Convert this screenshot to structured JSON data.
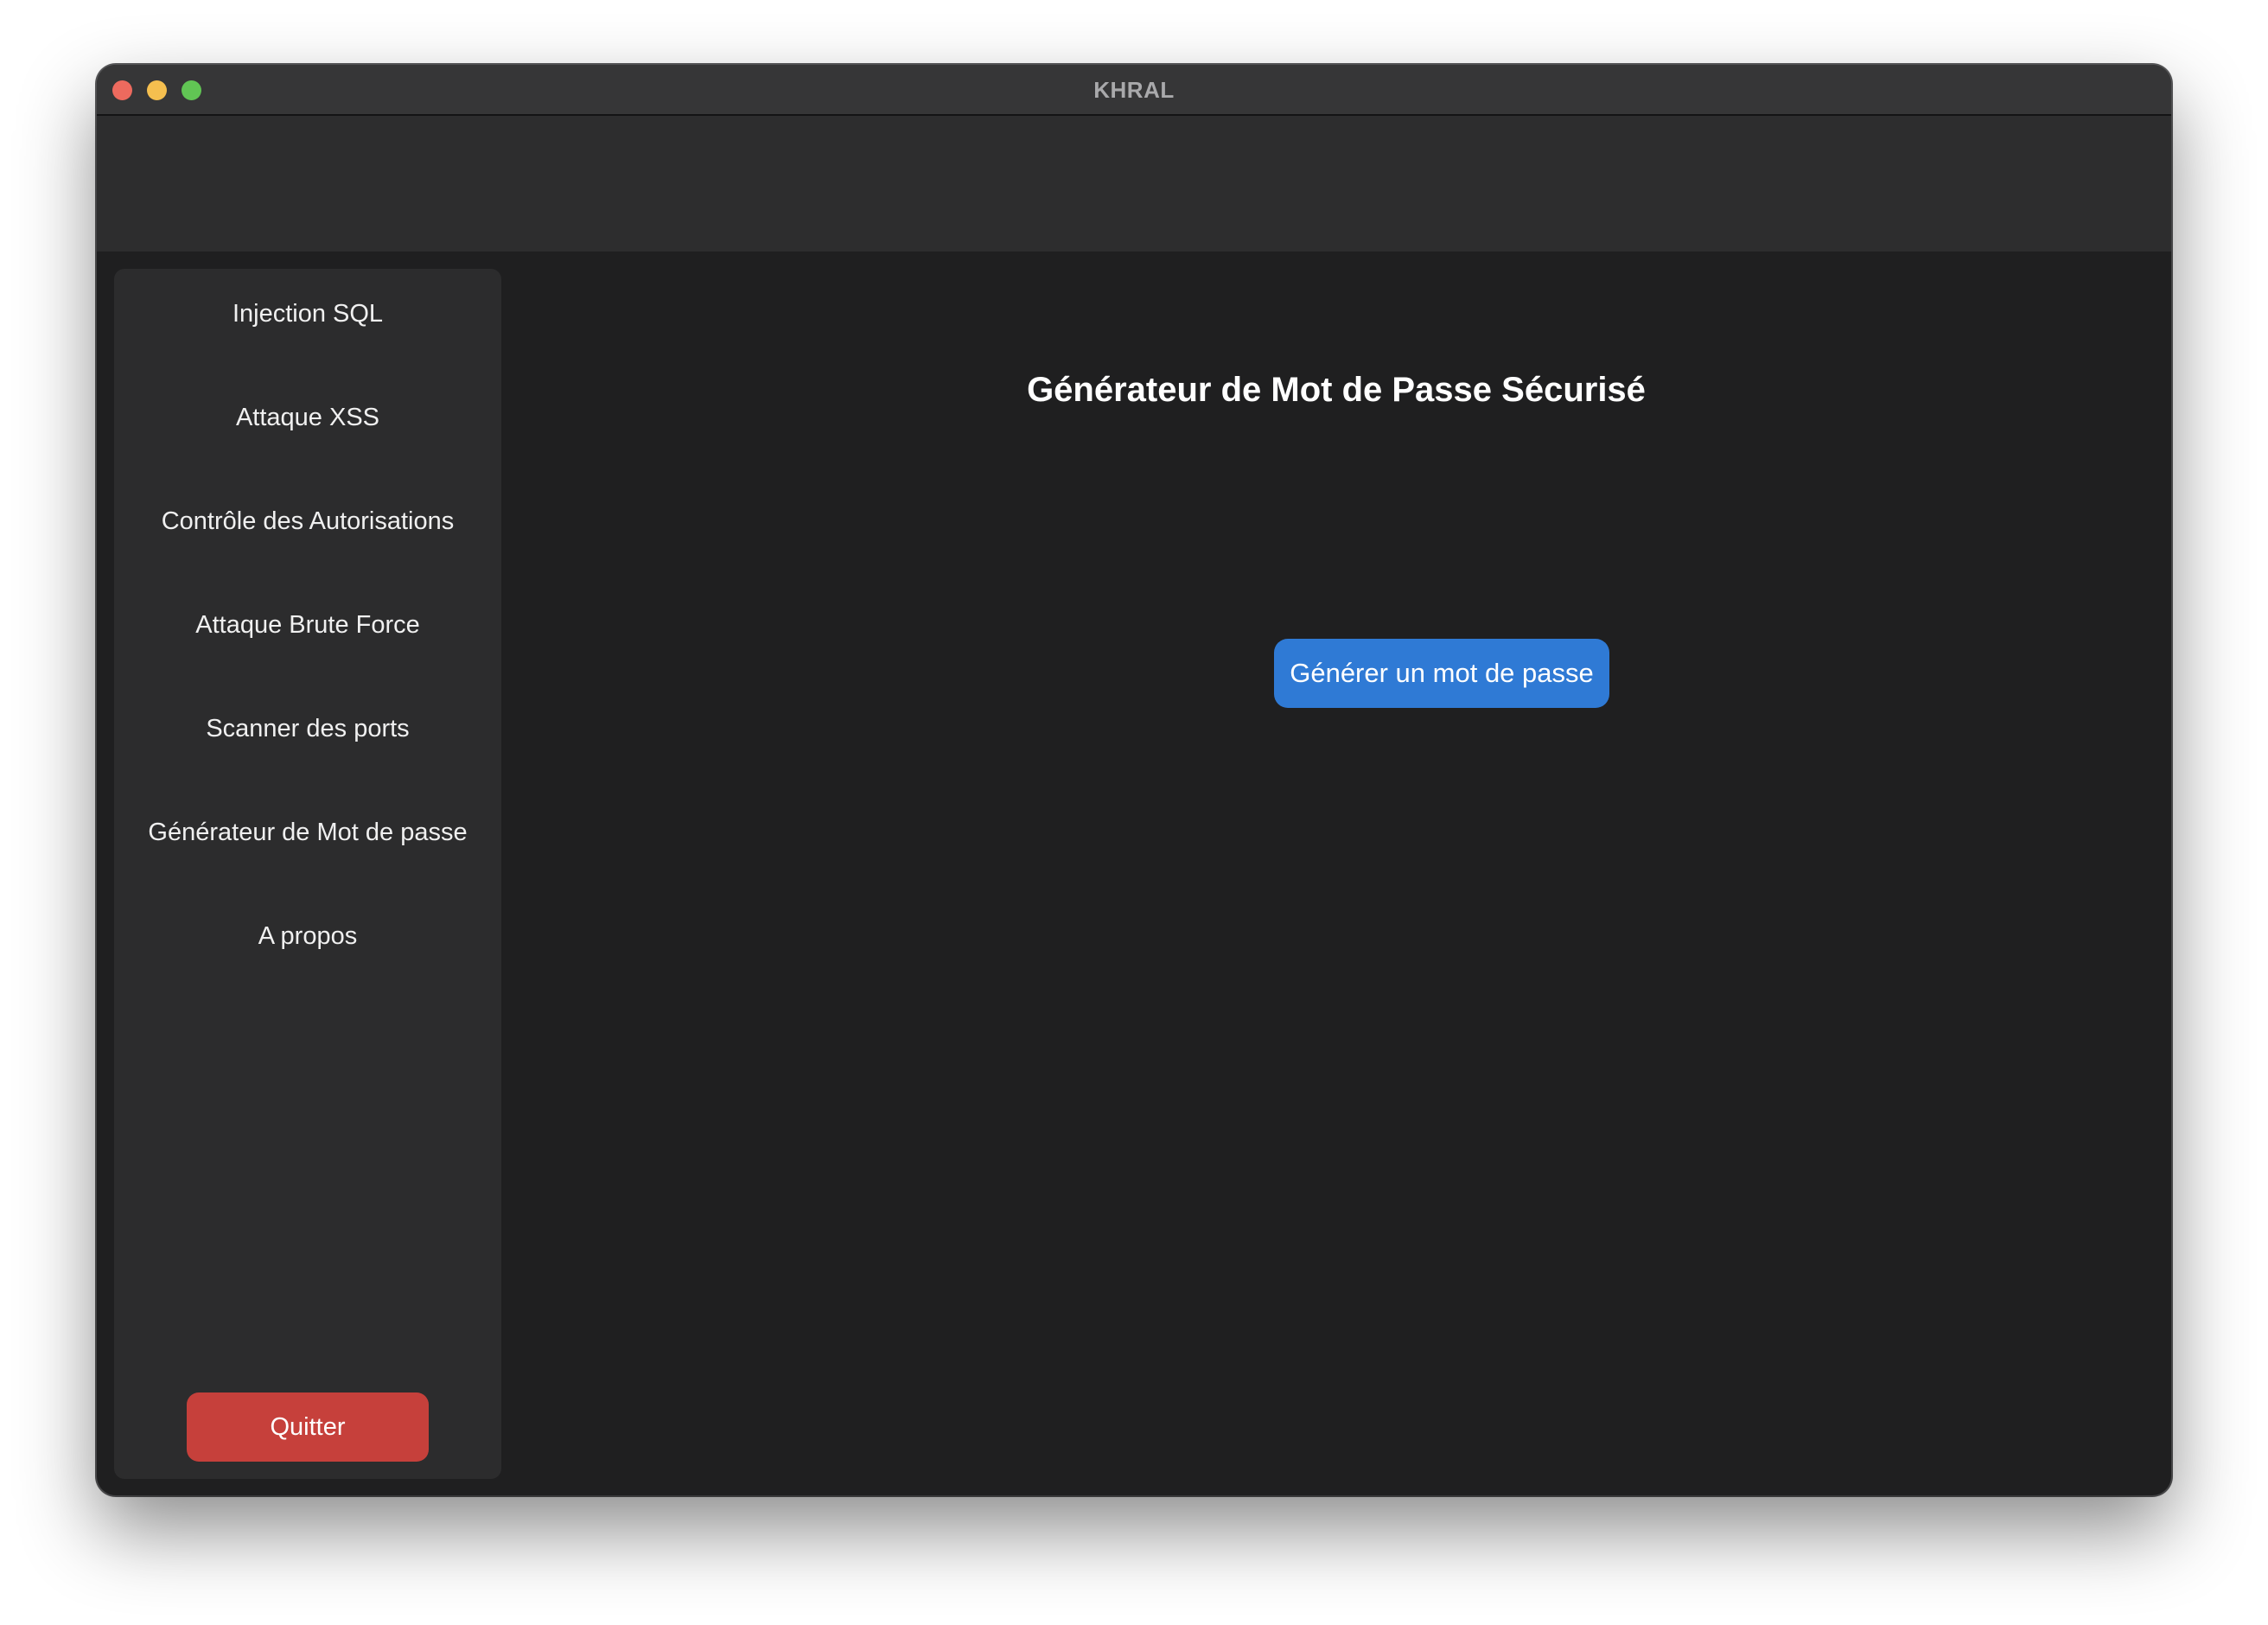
{
  "window": {
    "title": "KHRAL"
  },
  "sidebar": {
    "items": [
      {
        "label": "Injection SQL"
      },
      {
        "label": "Attaque XSS"
      },
      {
        "label": "Contrôle des Autorisations"
      },
      {
        "label": "Attaque Brute Force"
      },
      {
        "label": "Scanner des ports"
      },
      {
        "label": "Générateur de Mot de passe"
      },
      {
        "label": "A propos"
      }
    ],
    "quit_label": "Quitter"
  },
  "main": {
    "title": "Générateur de Mot de Passe Sécurisé",
    "generate_label": "Générer un mot de passe"
  },
  "colors": {
    "accent": "#2f7ad5",
    "danger": "#c6403b",
    "background": "#1f1f20",
    "sidebar": "#2c2c2d"
  }
}
